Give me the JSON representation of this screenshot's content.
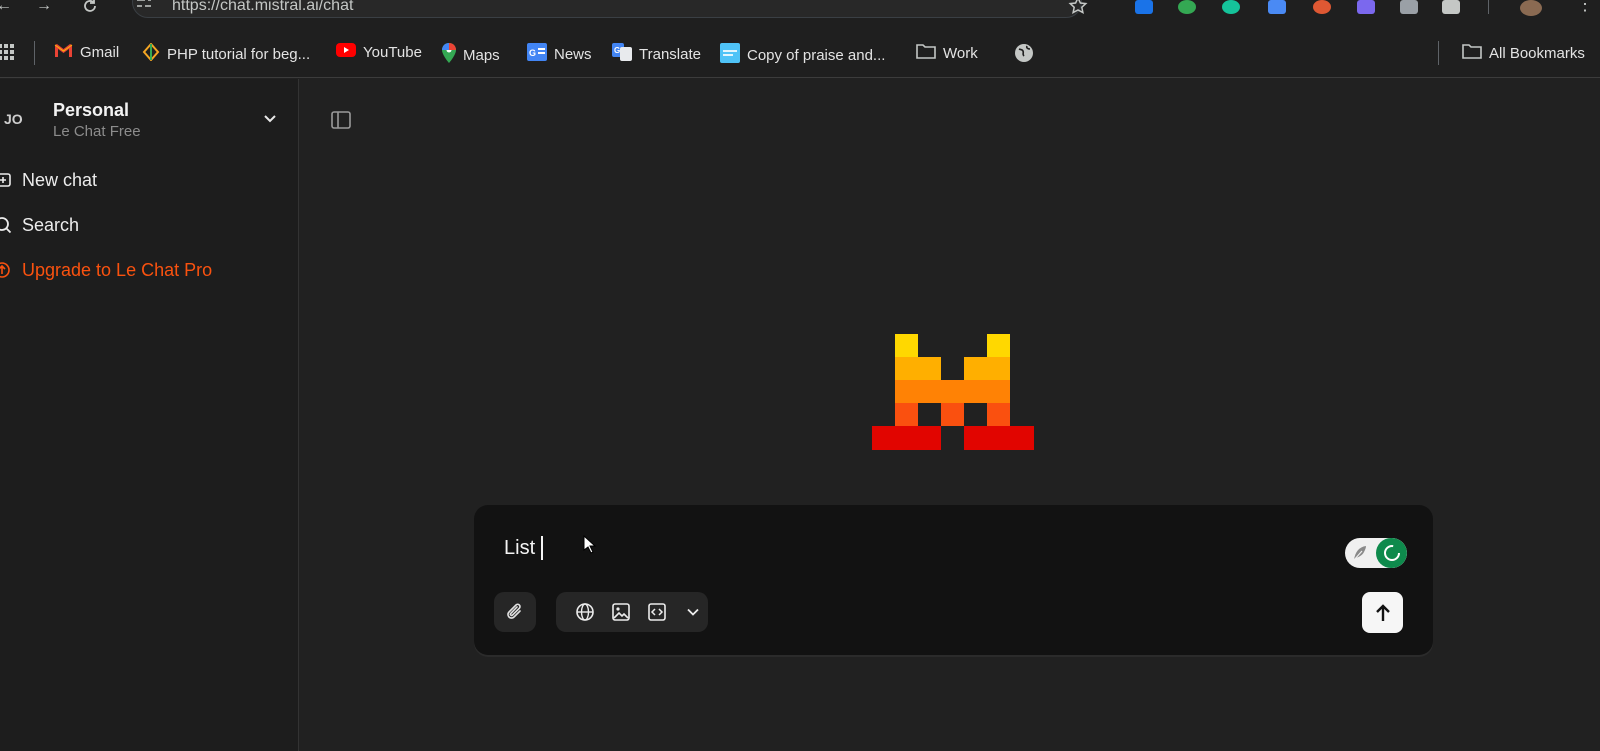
{
  "browser": {
    "url": "https://chat.mistral.ai/chat"
  },
  "bookmarks": {
    "items": [
      {
        "label": "Gmail",
        "icon": "gmail-icon",
        "color": "#ea4335"
      },
      {
        "label": "PHP tutorial for beg...",
        "icon": "php-tutorial-icon",
        "color": "#f5a623"
      },
      {
        "label": "YouTube",
        "icon": "youtube-icon",
        "color": "#ff0000"
      },
      {
        "label": "Maps",
        "icon": "maps-icon",
        "color": "#34a853"
      },
      {
        "label": "News",
        "icon": "news-icon",
        "color": "#4285f4"
      },
      {
        "label": "Translate",
        "icon": "translate-icon",
        "color": "#4285f4"
      },
      {
        "label": "Copy of praise and...",
        "icon": "doc-icon",
        "color": "#4fc3f7"
      },
      {
        "label": "Work",
        "icon": "folder-icon",
        "color": "#c4c7c5"
      },
      {
        "label": "",
        "icon": "globe-icon",
        "color": "#c4c7c5"
      }
    ],
    "all_bookmarks_label": "All Bookmarks"
  },
  "sidebar": {
    "avatar_initials": "JO",
    "workspace_name": "Personal",
    "workspace_plan": "Le Chat Free",
    "items": [
      {
        "label": "New chat",
        "icon": "new-chat-icon"
      },
      {
        "label": "Search",
        "icon": "search-icon"
      },
      {
        "label": "Upgrade to Le Chat Pro",
        "icon": "upgrade-icon"
      }
    ],
    "accent_color": "#fa520f"
  },
  "composer": {
    "input_value": "List",
    "toggle_state": "on",
    "toggle_color": "#0e8a4c"
  },
  "logo": {
    "colors": [
      "#ffd800",
      "#ffaf00",
      "#ff8205",
      "#fa500f",
      "#e10500"
    ]
  }
}
